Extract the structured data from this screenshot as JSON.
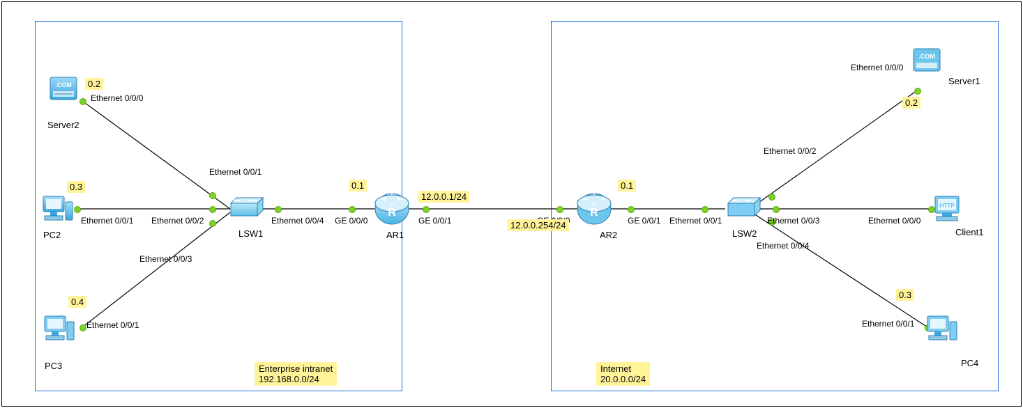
{
  "zones": {
    "left": {
      "title": "Enterprise intranet\n192.168.0.0/24"
    },
    "right": {
      "title": "Internet\n20.0.0.0/24"
    }
  },
  "devices": {
    "server2": {
      "name": "Server2",
      "ip_suffix": "0.2",
      "iface": "Ethernet 0/0/0"
    },
    "pc2": {
      "name": "PC2",
      "ip_suffix": "0.3",
      "iface": "Ethernet 0/0/1"
    },
    "pc3": {
      "name": "PC3",
      "ip_suffix": "0.4",
      "iface": "Ethernet 0/0/1"
    },
    "lsw1": {
      "name": "LSW1",
      "ports": {
        "e001": "Ethernet 0/0/1",
        "e002": "Ethernet 0/0/2",
        "e003": "Ethernet 0/0/3",
        "e004": "Ethernet 0/0/4"
      }
    },
    "ar1": {
      "name": "AR1",
      "ip_suffix": "0.1",
      "ports": {
        "ge000": "GE 0/0/0",
        "ge001": "GE 0/0/1"
      },
      "wan_ip": "12.0.0.1/24"
    },
    "ar2": {
      "name": "AR2",
      "ip_suffix": "0.1",
      "ports": {
        "ge000": "GE 0/0/0",
        "ge001": "GE 0/0/1"
      },
      "wan_ip": "12.0.0.254/24"
    },
    "lsw2": {
      "name": "LSW2",
      "ports": {
        "e001": "Ethernet 0/0/1",
        "e002": "Ethernet 0/0/2",
        "e003": "Ethernet 0/0/3",
        "e004": "Ethernet 0/0/4"
      }
    },
    "server1": {
      "name": "Server1",
      "ip_suffix": "0.2",
      "iface": "Ethernet 0/0/0"
    },
    "client1": {
      "name": "Client1",
      "iface": "Ethernet 0/0/0"
    },
    "pc4": {
      "name": "PC4",
      "ip_suffix": "0.3",
      "iface": "Ethernet 0/0/1"
    }
  }
}
